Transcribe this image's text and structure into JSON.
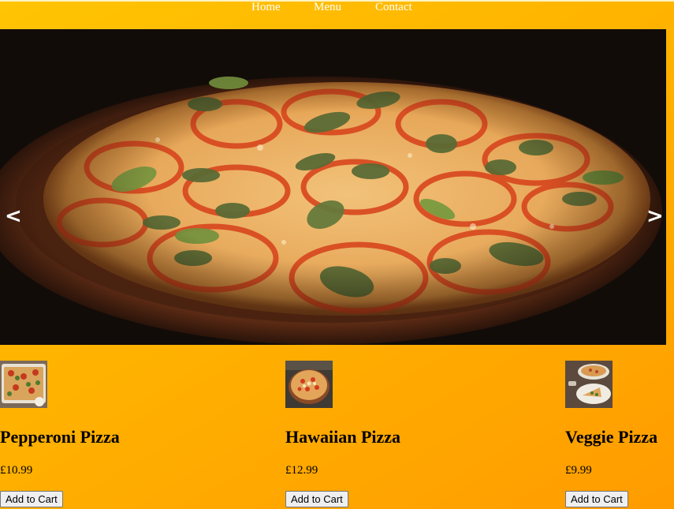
{
  "nav": {
    "items": [
      {
        "label": "Home"
      },
      {
        "label": "Menu"
      },
      {
        "label": "Contact"
      }
    ]
  },
  "carousel": {
    "prev_label": "<",
    "next_label": ">",
    "image": "pizza-margherita-with-tomato-slices-and-basil"
  },
  "products": [
    {
      "name": "Pepperoni Pizza",
      "price": "£10.99",
      "button_label": "Add to Cart",
      "thumbnail": "pizza-tray-thumbnail"
    },
    {
      "name": "Hawaiian Pizza",
      "price": "£12.99",
      "button_label": "Add to Cart",
      "thumbnail": "round-pizza-thumbnail"
    },
    {
      "name": "Veggie Pizza",
      "price": "£9.99",
      "button_label": "Add to Cart",
      "thumbnail": "pizza-plates-thumbnail"
    }
  ],
  "colors": {
    "page_gradient_start": "#ffc403",
    "page_gradient_end": "#ff9c00",
    "nav_text": "#ffffff"
  }
}
